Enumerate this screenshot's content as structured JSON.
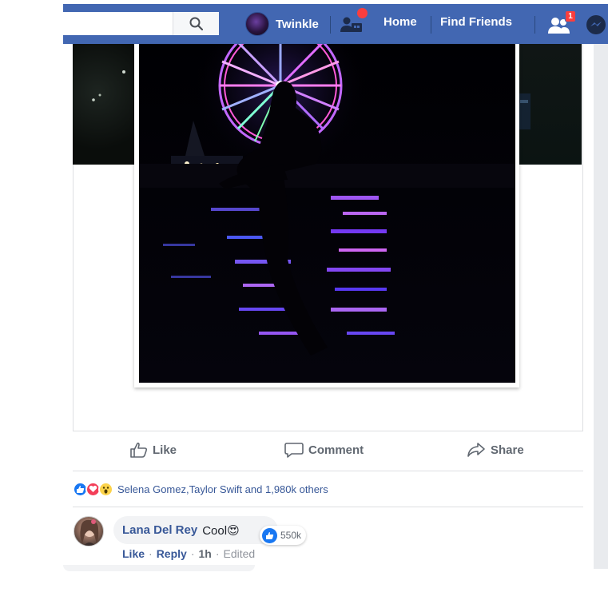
{
  "header": {
    "search": {
      "placeholder": ""
    },
    "profile_name": "Twinkle",
    "nav": {
      "home": "Home",
      "find_friends": "Find Friends"
    },
    "friend_requests_badge": "1",
    "icons": [
      "search-icon",
      "friend-requests-icon",
      "friends-icon",
      "messenger-icon"
    ],
    "brand_color": "#4267b2"
  },
  "post": {
    "actions": {
      "like": "Like",
      "comment": "Comment",
      "share": "Share"
    },
    "reactions": {
      "types": [
        "like",
        "love",
        "wow"
      ],
      "summary": "Selena Gomez,Taylor Swift and 1,980k others"
    }
  },
  "comment": {
    "author": "Lana Del Rey",
    "text": "Cool😍",
    "likes": "550k",
    "meta": {
      "like": "Like",
      "reply": "Reply",
      "time": "1h",
      "edited": "Edited"
    }
  }
}
